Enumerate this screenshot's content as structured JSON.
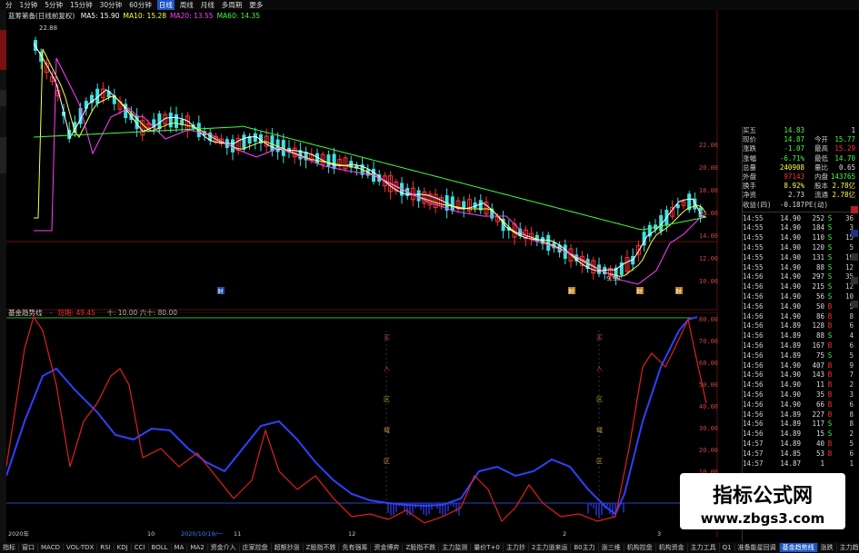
{
  "period_bar": {
    "items": [
      "分",
      "1分钟",
      "5分钟",
      "15分钟",
      "30分钟",
      "60分钟",
      "日线",
      "周线",
      "月线",
      "多周期",
      "更多"
    ],
    "active_index": 6
  },
  "main_chart": {
    "title": "蓝筹第备(日线前复权)",
    "ma_legend": [
      {
        "label": "MA5: 15.90",
        "color": "#ffffff"
      },
      {
        "label": "MA10: 15.28",
        "color": "#ffff40"
      },
      {
        "label": "MA20: 13.55",
        "color": "#ff40ff"
      },
      {
        "label": "MA60: 14.35",
        "color": "#40ff40"
      }
    ],
    "peak_label": "22.88",
    "low_label": "9.98",
    "price_axis": [
      "22.00",
      "20.00",
      "18.00",
      "16.00",
      "14.00",
      "12.00",
      "10.00"
    ],
    "markers": [
      "财",
      "财",
      "财",
      "财"
    ]
  },
  "indicator": {
    "title": "基金趋势线",
    "legend": [
      {
        "label": "-",
        "color": "#4060ff"
      },
      {
        "label": "短期: 49.45",
        "color": "#ff3030"
      }
    ],
    "extra_legend": "十: 10.00  六十: 80.00",
    "axis": [
      "80.00",
      "70.00",
      "60.00",
      "50.00",
      "40.00",
      "30.00",
      "20.00",
      "10.00"
    ],
    "tags": [
      "买",
      "入",
      "区",
      "域",
      "区"
    ],
    "date_labels": [
      "2020年",
      "10",
      "2020/10/19/一",
      "11",
      "12",
      "2",
      "3"
    ]
  },
  "quote": {
    "rows": [
      {
        "label": "买五",
        "v1": "14.83",
        "label2": "",
        "v2": "1",
        "c1": "#40ff40",
        "c2": "#ddd"
      },
      {
        "label": "现价",
        "v1": "14.87",
        "label2": "今开",
        "v2": "15.77",
        "c1": "#40ff40",
        "c2": "#40ff40"
      },
      {
        "label": "涨跌",
        "v1": "-1.07",
        "label2": "最高",
        "v2": "15.29",
        "c1": "#40ff40",
        "c2": "#ff3030"
      },
      {
        "label": "涨幅",
        "v1": "-6.71%",
        "label2": "最低",
        "v2": "14.70",
        "c1": "#40ff40",
        "c2": "#40ff40"
      },
      {
        "label": "总量",
        "v1": "240908",
        "label2": "量比",
        "v2": "0.65",
        "c1": "#ffff40",
        "c2": "#ddd"
      },
      {
        "label": "外盘",
        "v1": "97143",
        "label2": "内盘",
        "v2": "143765",
        "c1": "#ff3030",
        "c2": "#40ff40"
      },
      {
        "label": "换手",
        "v1": "8.92%",
        "label2": "股本",
        "v2": "2.78亿",
        "c1": "#ffff40",
        "c2": "#ffff40"
      },
      {
        "label": "净资",
        "v1": "2.73",
        "label2": "流通",
        "v2": "2.78亿",
        "c1": "#ddd",
        "c2": "#ffff40"
      },
      {
        "label": "收益(四)",
        "v1": "-0.187",
        "label2": "PE(动)",
        "v2": "",
        "c1": "#ddd",
        "c2": "#ddd"
      }
    ],
    "ticks": [
      {
        "time": "14:55",
        "price": "14.90",
        "vol": "252",
        "side": "S",
        "n": "36"
      },
      {
        "time": "14:55",
        "price": "14.90",
        "vol": "184",
        "side": "S",
        "n": "3"
      },
      {
        "time": "14:55",
        "price": "14.90",
        "vol": "110",
        "side": "S",
        "n": "15"
      },
      {
        "time": "14:55",
        "price": "14.90",
        "vol": "120",
        "side": "S",
        "n": "5"
      },
      {
        "time": "14:55",
        "price": "14.90",
        "vol": "131",
        "side": "S",
        "n": "19"
      },
      {
        "time": "14:55",
        "price": "14.90",
        "vol": "88",
        "side": "S",
        "n": "12"
      },
      {
        "time": "14:56",
        "price": "14.90",
        "vol": "297",
        "side": "S",
        "n": "35"
      },
      {
        "time": "14:56",
        "price": "14.90",
        "vol": "215",
        "side": "S",
        "n": "12"
      },
      {
        "time": "14:56",
        "price": "14.90",
        "vol": "56",
        "side": "S",
        "n": "10"
      },
      {
        "time": "14:56",
        "price": "14.90",
        "vol": "50",
        "side": "B",
        "n": "5"
      },
      {
        "time": "14:56",
        "price": "14.90",
        "vol": "86",
        "side": "B",
        "n": "8"
      },
      {
        "time": "14:56",
        "price": "14.89",
        "vol": "128",
        "side": "B",
        "n": "6"
      },
      {
        "time": "14:56",
        "price": "14.89",
        "vol": "88",
        "side": "S",
        "n": "4"
      },
      {
        "time": "14:56",
        "price": "14.89",
        "vol": "167",
        "side": "B",
        "n": "6"
      },
      {
        "time": "14:56",
        "price": "14.89",
        "vol": "75",
        "side": "S",
        "n": "5"
      },
      {
        "time": "14:56",
        "price": "14.90",
        "vol": "407",
        "side": "B",
        "n": "9"
      },
      {
        "time": "14:56",
        "price": "14.90",
        "vol": "143",
        "side": "B",
        "n": "7"
      },
      {
        "time": "14:56",
        "price": "14.90",
        "vol": "11",
        "side": "B",
        "n": "2"
      },
      {
        "time": "14:56",
        "price": "14.90",
        "vol": "35",
        "side": "B",
        "n": "3"
      },
      {
        "time": "14:56",
        "price": "14.90",
        "vol": "66",
        "side": "B",
        "n": "6"
      },
      {
        "time": "14:56",
        "price": "14.89",
        "vol": "227",
        "side": "B",
        "n": "8"
      },
      {
        "time": "14:56",
        "price": "14.89",
        "vol": "117",
        "side": "S",
        "n": "8"
      },
      {
        "time": "14:56",
        "price": "14.89",
        "vol": "15",
        "side": "S",
        "n": "2"
      },
      {
        "time": "14:57",
        "price": "14.89",
        "vol": "40",
        "side": "B",
        "n": "5"
      },
      {
        "time": "14:57",
        "price": "14.85",
        "vol": "53",
        "side": "B",
        "n": "6"
      },
      {
        "time": "14:57",
        "price": "14.87",
        "vol": "1",
        "side": "",
        "n": "1"
      }
    ]
  },
  "bottom_tabs": {
    "items": [
      "指标",
      "窗口",
      "MACD",
      "VOL-TDX",
      "RSI",
      "KDJ",
      "CCI",
      "BOLL",
      "MA",
      "MA2",
      "资金介入",
      "庄家控盘",
      "超额抄涨",
      "Z股指不跌",
      "先有强筹",
      "资金博弈",
      "Z股指不跌",
      "主力监测",
      "量价T+0",
      "主力抄",
      "2主力道来运",
      "B0主力",
      "涨三维",
      "机构控盘",
      "机构资金",
      "主力工具",
      "Q1",
      "准备能星回调",
      "基金趋势线",
      "涨跌",
      "主力趋"
    ],
    "active_index": 28
  },
  "watermark": {
    "title": "指标公式网",
    "url": "www.zbgs3.com"
  },
  "colors": {
    "up": "#ff3030",
    "down": "#40e0e0",
    "ma5": "#ffffff",
    "ma10": "#ffff40",
    "ma20": "#ff40ff",
    "ma60": "#40ff40",
    "long_line": "#3040ff",
    "short_line": "#e02020"
  }
}
